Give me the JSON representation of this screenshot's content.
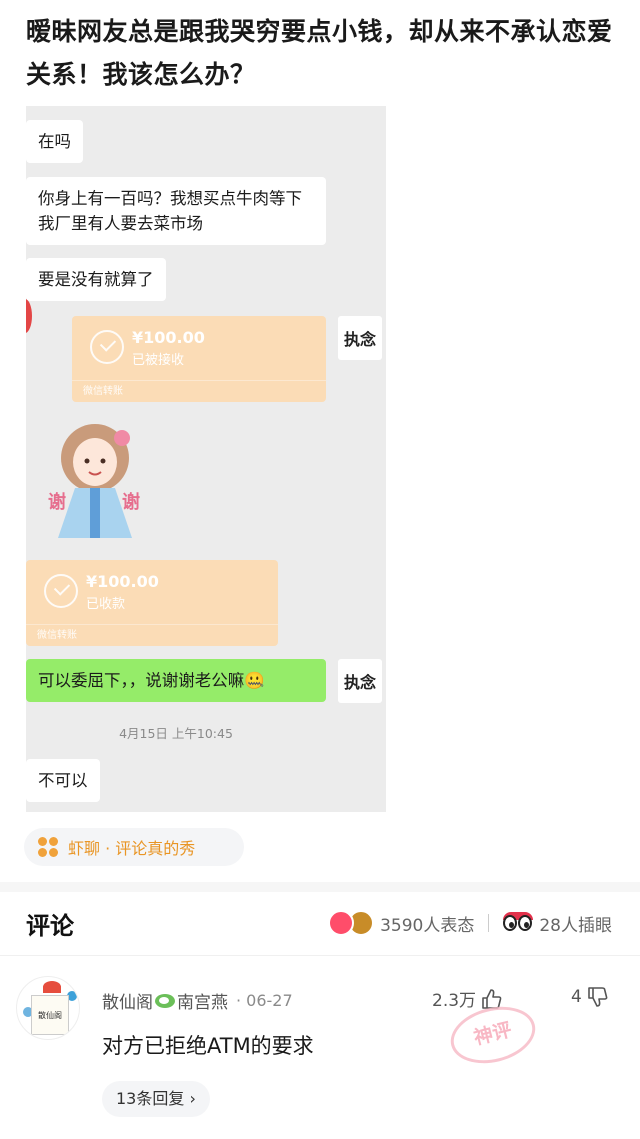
{
  "post": {
    "title": "暧昧网友总是跟我哭穷要点小钱，却从来不承认恋爱关系！我该怎么办？"
  },
  "chat": {
    "messages": [
      {
        "text": "在吗"
      },
      {
        "text": "你身上有一百吗？我想买点牛肉等下我厂里有人要去菜市场"
      },
      {
        "text": "要是没有就算了"
      },
      {
        "text": "可以委屈下，，说谢谢老公嘛🤐"
      },
      {
        "text": "不可以"
      }
    ],
    "transfers": [
      {
        "amount": "¥100.00",
        "status": "已被接收",
        "footer": "微信转账"
      },
      {
        "amount": "¥100.00",
        "status": "已收款",
        "footer": "微信转账"
      }
    ],
    "timestamp": "4月15日 上午10:45",
    "my_avatar_text": "执念"
  },
  "topic": {
    "label": "虾聊 · 评论真的秀"
  },
  "comments_header": {
    "title": "评论",
    "reactions": "3590人表态",
    "views": "28人插眼"
  },
  "comment": {
    "author": "散仙阁",
    "author2": "南宫燕",
    "date": "· 06-27",
    "likes": "2.3万",
    "dislikes": "4",
    "text": "对方已拒绝ATM的要求",
    "badge": "神评",
    "avatar_text": "散仙阁",
    "replies": "13条回复 ›"
  },
  "colors": {
    "wechat_green": "#95ec69",
    "transfer_bg": "#fbdcb6",
    "accent_orange": "#e99524"
  }
}
